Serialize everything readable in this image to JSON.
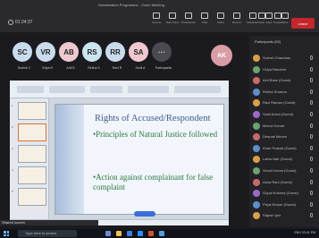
{
  "window": {
    "title": "Sensitization Programme - Zoom Meeting",
    "time_label": "01:24:37"
  },
  "toolbar": {
    "buttons": [
      {
        "icon": "audio-icon",
        "label": "Unmute"
      },
      {
        "icon": "video-icon",
        "label": "Start Video"
      },
      {
        "icon": "participants-icon",
        "label": "Participants"
      },
      {
        "icon": "chat-icon",
        "label": "Chat"
      },
      {
        "icon": "share-icon",
        "label": "Share"
      },
      {
        "icon": "record-icon",
        "label": "Record"
      },
      {
        "icon": "reactions-icon",
        "label": "Reactions"
      },
      {
        "icon": "apps-icon",
        "label": "Apps"
      },
      {
        "icon": "more-icon",
        "label": "More"
      }
    ],
    "right_buttons": [
      {
        "icon": "view-icon",
        "label": "View"
      },
      {
        "icon": "people-icon",
        "label": "People"
      }
    ],
    "leave_label": "Leave"
  },
  "participants_strip": [
    {
      "initials": "SC",
      "name": "Suresh C",
      "color": "#c9dcee"
    },
    {
      "initials": "VR",
      "name": "Vidya R",
      "color": "#c9dcee"
    },
    {
      "initials": "AB",
      "name": "Anil B",
      "color": "#f0c8d0"
    },
    {
      "initials": "RS",
      "name": "Rekha S",
      "color": "#c9e6f0"
    },
    {
      "initials": "RR",
      "name": "Ravi R",
      "color": "#c9dcee"
    },
    {
      "initials": "SA",
      "name": "Sunil A",
      "color": "#f0c8d0"
    },
    {
      "initials": "",
      "name": "Participants",
      "color": "#4a4a50"
    }
  ],
  "self_view": {
    "initials": "AK"
  },
  "slide": {
    "title": "Rights of Accused/Respondent",
    "bullets": [
      "•Principles of Natural Justice followed",
      "•Action against complainant for false complaint"
    ]
  },
  "shared_screen_label": "Shared screen",
  "panel": {
    "header": "Participants (52)",
    "people": [
      {
        "name": "Suresh Chandran",
        "color": "#d9a04a"
      },
      {
        "name": "Vidya Ramesh",
        "color": "#6aa36f"
      },
      {
        "name": "Anil Bose (Guest)",
        "color": "#c76b6b"
      },
      {
        "name": "Rekha Sharma",
        "color": "#5c8fcc"
      },
      {
        "name": "Ravi Raman (Guest)",
        "color": "#d9a04a"
      },
      {
        "name": "Sunil Arora (Guest)",
        "color": "#9b6ac7"
      },
      {
        "name": "Meera Kumar",
        "color": "#6aa36f"
      },
      {
        "name": "Deepak Menon",
        "color": "#c76b6b"
      },
      {
        "name": "Kiran Prasad (Guest)",
        "color": "#5c8fcc"
      },
      {
        "name": "Latha Nair (Guest)",
        "color": "#d9a04a"
      },
      {
        "name": "Vinod Kumar (Guest)",
        "color": "#6aa36f"
      },
      {
        "name": "Asha Rani (Guest)",
        "color": "#c76b6b"
      },
      {
        "name": "Gopal Krishna (Guest)",
        "color": "#9b6ac7"
      },
      {
        "name": "Priya Mohan (Guest)",
        "color": "#5c8fcc"
      },
      {
        "name": "Rajesh Iyer",
        "color": "#d9a04a"
      }
    ]
  },
  "taskbar": {
    "search_placeholder": "Type here to search",
    "tray_text": "ENG 03:41 PM"
  }
}
